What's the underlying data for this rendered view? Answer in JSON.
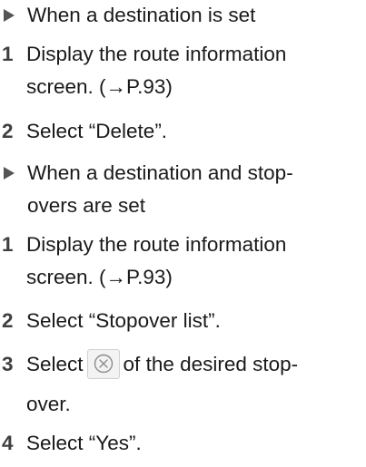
{
  "sections": [
    {
      "condition": "When a destination is set",
      "steps": [
        {
          "number": "1",
          "line1": "Display the route information",
          "line2": "screen. (→P.93)"
        },
        {
          "number": "2",
          "line1": "Select “Delete”."
        }
      ]
    },
    {
      "condition_line1": "When a destination and stop-",
      "condition_line2": "overs are set",
      "steps": [
        {
          "number": "1",
          "line1": "Display the route information",
          "line2": "screen. (→P.93)"
        },
        {
          "number": "2",
          "line1": "Select “Stopover list”."
        },
        {
          "number": "3",
          "line1_before": "Select",
          "line1_after": "of the desired stop-",
          "line2": "over.",
          "icon": "remove-circle-x-icon"
        },
        {
          "number": "4",
          "line1": "Select “Yes”."
        }
      ]
    }
  ],
  "colors": {
    "text": "#1a1a1a",
    "step_number": "#3f3f3f",
    "marker": "#555555",
    "icon_bg": "#f3f3f3",
    "icon_stroke": "#8c8c8c"
  }
}
